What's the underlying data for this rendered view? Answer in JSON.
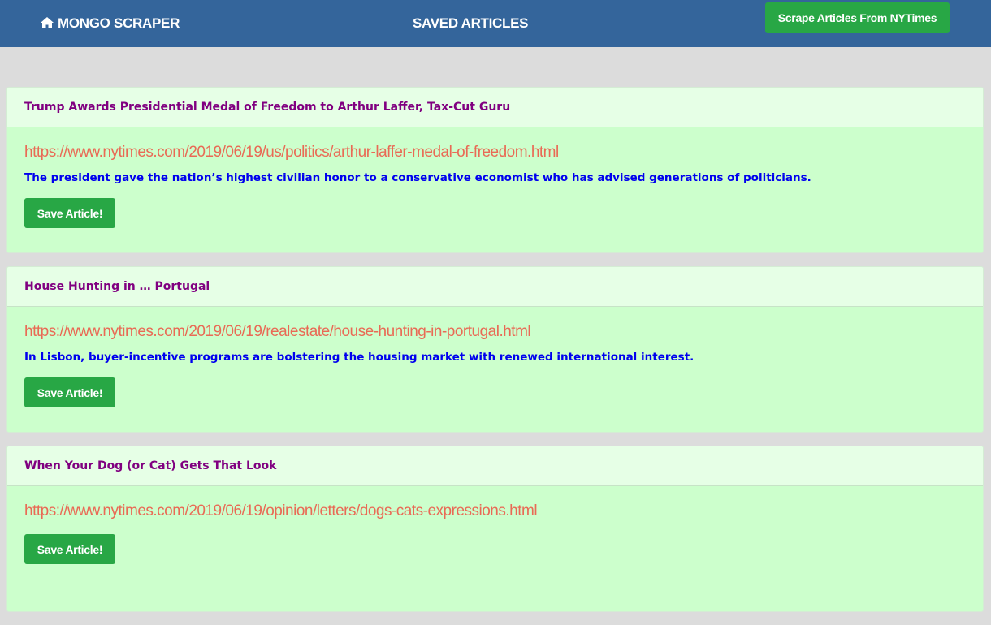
{
  "navbar": {
    "brand": "MONGO SCRAPER",
    "brand_icon": "home-icon",
    "center_link": "SAVED ARTICLES",
    "scrape_button": "Scrape Articles From NYTimes"
  },
  "colors": {
    "navbar": "#34659b",
    "button": "#28a745",
    "card_header": "#e6ffe6",
    "card_body": "#ccffcc",
    "title": "#800080",
    "link": "#e96a55",
    "summary": "#0000ee"
  },
  "articles": [
    {
      "title": "Trump Awards Presidential Medal of Freedom to Arthur Laffer, Tax-Cut Guru",
      "link": "https://www.nytimes.com/2019/06/19/us/politics/arthur-laffer-medal-of-freedom.html",
      "summary": "The president gave the nation’s highest civilian honor to a conservative economist who has advised generations of politicians.",
      "button": "Save Article!"
    },
    {
      "title": "House Hunting in … Portugal",
      "link": "https://www.nytimes.com/2019/06/19/realestate/house-hunting-in-portugal.html",
      "summary": "In Lisbon, buyer-incentive programs are bolstering the housing market with renewed international interest.",
      "button": "Save Article!"
    },
    {
      "title": "When Your Dog (or Cat) Gets That Look",
      "link": "https://www.nytimes.com/2019/06/19/opinion/letters/dogs-cats-expressions.html",
      "summary": "",
      "button": "Save Article!"
    }
  ]
}
